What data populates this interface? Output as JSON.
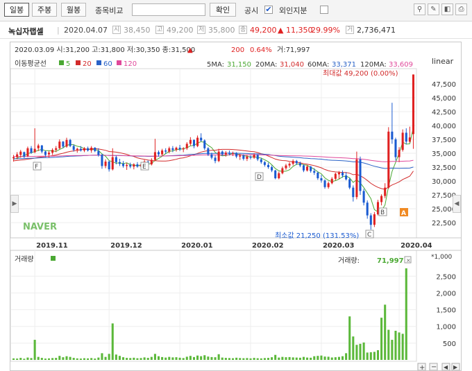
{
  "toolbar": {
    "period_buttons": [
      "일봉",
      "주봉",
      "월봉"
    ],
    "compare_label": "종목비교",
    "compare_placeholder": "",
    "confirm_button": "확인",
    "disclosure_label": "공시",
    "disclosure_checked": true,
    "foreign_label": "외인지분",
    "foreign_checked": false,
    "icons": [
      "pin-icon",
      "draw-icon",
      "toggle-panel-icon",
      "print-icon"
    ]
  },
  "stock": {
    "name": "녹십자랩셀",
    "date": "2020.04.07",
    "open_badge": "시",
    "open": "38,450",
    "high_badge": "고",
    "high": "49,200",
    "low_badge": "저",
    "low": "35,800",
    "close_badge": "종",
    "close": "49,200",
    "change": "▲ 11,350",
    "change_pct": "29.99%",
    "volume_badge": "거",
    "volume": "2,736,471",
    "up_color": "#e02121",
    "down_color": "#1a5bd1"
  },
  "chart_header": {
    "line1": "2020.03.09 시:31,200 고:31,800 저:30,350 종:31,500",
    "line1_change": "▲",
    "line1_change_val": "200",
    "line1_pct": "0.64%",
    "line1_vol": "거:71,997",
    "ma_title": "이동평균선",
    "ma_legend": [
      {
        "label": "5",
        "color": "#4aa832"
      },
      {
        "label": "20",
        "color": "#d22b2b"
      },
      {
        "label": "60",
        "color": "#2962c7"
      },
      {
        "label": "120",
        "color": "#e0489a"
      }
    ],
    "ma_values": [
      {
        "label": "5MA:",
        "value": "31,150",
        "color": "#4aa832"
      },
      {
        "label": "20MA:",
        "value": "31,040",
        "color": "#d22b2b"
      },
      {
        "label": "60MA:",
        "value": "33,371",
        "color": "#2962c7"
      },
      {
        "label": "120MA:",
        "value": "33,609",
        "color": "#e0489a"
      }
    ],
    "scale_mode": "linear"
  },
  "annotations": {
    "max_label": "최대값 49,200 (0.00%)",
    "min_label": "최소값 21,250 (131.53%)",
    "watermark": "NAVER",
    "markers": [
      "F",
      "E",
      "D",
      "C",
      "B",
      "A"
    ]
  },
  "volume_header": {
    "title": "거래량",
    "value_label": "거래량:",
    "value": "71,997",
    "unit": "*1,000"
  },
  "chart_data": [
    {
      "type": "candlestick",
      "title": "",
      "ylabel": "",
      "x_ticks": [
        "2019.11",
        "2019.12",
        "2020.01",
        "2020.02",
        "2020.03",
        "2020.04"
      ],
      "y_ticks": [
        22500,
        25000,
        27500,
        30000,
        32500,
        35000,
        37500,
        40000,
        42500,
        45000,
        47500
      ],
      "ylim": [
        20000,
        50000
      ],
      "candles": [
        {
          "d": "10-24",
          "o": 34100,
          "h": 34700,
          "l": 33500,
          "c": 34300
        },
        {
          "d": "10-25",
          "o": 34300,
          "h": 35200,
          "l": 33900,
          "c": 34800
        },
        {
          "d": "10-28",
          "o": 34700,
          "h": 35600,
          "l": 34200,
          "c": 35300
        },
        {
          "d": "10-29",
          "o": 35200,
          "h": 35300,
          "l": 34100,
          "c": 34400
        },
        {
          "d": "10-30",
          "o": 34500,
          "h": 36200,
          "l": 34300,
          "c": 35900
        },
        {
          "d": "10-31",
          "o": 35900,
          "h": 36300,
          "l": 34900,
          "c": 35100
        },
        {
          "d": "11-01",
          "o": 35200,
          "h": 39500,
          "l": 35000,
          "c": 35800
        },
        {
          "d": "11-04",
          "o": 35900,
          "h": 36700,
          "l": 35400,
          "c": 36400
        },
        {
          "d": "11-05",
          "o": 36400,
          "h": 36500,
          "l": 35000,
          "c": 35300
        },
        {
          "d": "11-06",
          "o": 35300,
          "h": 35500,
          "l": 34300,
          "c": 34700
        },
        {
          "d": "11-07",
          "o": 34800,
          "h": 35400,
          "l": 34200,
          "c": 35100
        },
        {
          "d": "11-08",
          "o": 35100,
          "h": 35900,
          "l": 34700,
          "c": 35600
        },
        {
          "d": "11-11",
          "o": 35600,
          "h": 36300,
          "l": 35200,
          "c": 35900
        },
        {
          "d": "11-12",
          "o": 35900,
          "h": 37500,
          "l": 35700,
          "c": 37100
        },
        {
          "d": "11-13",
          "o": 37100,
          "h": 37200,
          "l": 35900,
          "c": 36200
        },
        {
          "d": "11-14",
          "o": 36200,
          "h": 37800,
          "l": 36000,
          "c": 37400
        },
        {
          "d": "11-15",
          "o": 37400,
          "h": 37600,
          "l": 36100,
          "c": 36300
        },
        {
          "d": "11-18",
          "o": 36300,
          "h": 36600,
          "l": 35300,
          "c": 35600
        },
        {
          "d": "11-19",
          "o": 35600,
          "h": 36000,
          "l": 35100,
          "c": 35800
        },
        {
          "d": "11-20",
          "o": 35800,
          "h": 36300,
          "l": 35300,
          "c": 35500
        },
        {
          "d": "11-21",
          "o": 35500,
          "h": 36100,
          "l": 35200,
          "c": 35900
        },
        {
          "d": "11-22",
          "o": 35900,
          "h": 36200,
          "l": 35300,
          "c": 35500
        },
        {
          "d": "11-25",
          "o": 35500,
          "h": 36300,
          "l": 35100,
          "c": 36000
        },
        {
          "d": "11-26",
          "o": 36000,
          "h": 36100,
          "l": 35200,
          "c": 35400
        },
        {
          "d": "11-27",
          "o": 35400,
          "h": 35900,
          "l": 34400,
          "c": 34700
        },
        {
          "d": "11-28",
          "o": 34700,
          "h": 34900,
          "l": 32200,
          "c": 32700
        },
        {
          "d": "11-29",
          "o": 32700,
          "h": 33900,
          "l": 32300,
          "c": 33500
        },
        {
          "d": "12-02",
          "o": 33500,
          "h": 33700,
          "l": 31700,
          "c": 32100
        },
        {
          "d": "12-03",
          "o": 32100,
          "h": 35900,
          "l": 31900,
          "c": 34300
        },
        {
          "d": "12-04",
          "o": 34300,
          "h": 34600,
          "l": 33000,
          "c": 33400
        },
        {
          "d": "12-05",
          "o": 33400,
          "h": 34000,
          "l": 32700,
          "c": 33100
        },
        {
          "d": "12-06",
          "o": 33100,
          "h": 33600,
          "l": 32400,
          "c": 32700
        },
        {
          "d": "12-09",
          "o": 32700,
          "h": 33300,
          "l": 32000,
          "c": 32900
        },
        {
          "d": "12-10",
          "o": 32900,
          "h": 33300,
          "l": 32300,
          "c": 32600
        },
        {
          "d": "12-11",
          "o": 32600,
          "h": 33200,
          "l": 32100,
          "c": 33000
        },
        {
          "d": "12-12",
          "o": 33000,
          "h": 33400,
          "l": 32400,
          "c": 32600
        },
        {
          "d": "12-13",
          "o": 32600,
          "h": 33200,
          "l": 32300,
          "c": 33000
        },
        {
          "d": "12-16",
          "o": 33000,
          "h": 33800,
          "l": 32600,
          "c": 33500
        },
        {
          "d": "12-17",
          "o": 33500,
          "h": 33700,
          "l": 32700,
          "c": 33000
        },
        {
          "d": "12-18",
          "o": 33000,
          "h": 34100,
          "l": 32800,
          "c": 33800
        },
        {
          "d": "12-19",
          "o": 33800,
          "h": 37600,
          "l": 33600,
          "c": 35200
        },
        {
          "d": "12-20",
          "o": 35200,
          "h": 35500,
          "l": 34400,
          "c": 34800
        },
        {
          "d": "12-23",
          "o": 34800,
          "h": 35800,
          "l": 34500,
          "c": 35500
        },
        {
          "d": "12-24",
          "o": 35500,
          "h": 35900,
          "l": 34900,
          "c": 35300
        },
        {
          "d": "12-26",
          "o": 35300,
          "h": 36200,
          "l": 35000,
          "c": 35900
        },
        {
          "d": "12-27",
          "o": 35900,
          "h": 36300,
          "l": 35200,
          "c": 35600
        },
        {
          "d": "12-30",
          "o": 35600,
          "h": 36200,
          "l": 35300,
          "c": 36000
        },
        {
          "d": "01-02",
          "o": 36000,
          "h": 36500,
          "l": 35400,
          "c": 35700
        },
        {
          "d": "01-03",
          "o": 35700,
          "h": 36100,
          "l": 35200,
          "c": 35900
        },
        {
          "d": "01-06",
          "o": 35900,
          "h": 37000,
          "l": 35600,
          "c": 36700
        },
        {
          "d": "01-07",
          "o": 36700,
          "h": 37900,
          "l": 36400,
          "c": 37400
        },
        {
          "d": "01-08",
          "o": 37400,
          "h": 37500,
          "l": 35900,
          "c": 36300
        },
        {
          "d": "01-09",
          "o": 36300,
          "h": 38200,
          "l": 36100,
          "c": 37800
        },
        {
          "d": "01-10",
          "o": 37800,
          "h": 38600,
          "l": 37100,
          "c": 37300
        },
        {
          "d": "01-13",
          "o": 37300,
          "h": 37500,
          "l": 35600,
          "c": 35900
        },
        {
          "d": "01-14",
          "o": 35900,
          "h": 36100,
          "l": 34500,
          "c": 34800
        },
        {
          "d": "01-15",
          "o": 34800,
          "h": 35100,
          "l": 33900,
          "c": 34200
        },
        {
          "d": "01-16",
          "o": 34200,
          "h": 34600,
          "l": 33200,
          "c": 33600
        },
        {
          "d": "01-17",
          "o": 33600,
          "h": 35800,
          "l": 33400,
          "c": 35300
        },
        {
          "d": "01-20",
          "o": 35300,
          "h": 35500,
          "l": 34500,
          "c": 34800
        },
        {
          "d": "01-21",
          "o": 34800,
          "h": 35400,
          "l": 34400,
          "c": 35100
        },
        {
          "d": "01-22",
          "o": 35100,
          "h": 35500,
          "l": 34600,
          "c": 34900
        },
        {
          "d": "01-23",
          "o": 34900,
          "h": 35300,
          "l": 34500,
          "c": 35000
        },
        {
          "d": "01-28",
          "o": 35000,
          "h": 35200,
          "l": 34100,
          "c": 34400
        },
        {
          "d": "01-29",
          "o": 34400,
          "h": 34900,
          "l": 33800,
          "c": 34600
        },
        {
          "d": "01-30",
          "o": 34600,
          "h": 34800,
          "l": 33700,
          "c": 34000
        },
        {
          "d": "01-31",
          "o": 34000,
          "h": 34700,
          "l": 33600,
          "c": 34400
        },
        {
          "d": "02-03",
          "o": 34400,
          "h": 34600,
          "l": 33900,
          "c": 34200
        },
        {
          "d": "02-04",
          "o": 34200,
          "h": 35000,
          "l": 34000,
          "c": 34700
        },
        {
          "d": "02-05",
          "o": 34700,
          "h": 34800,
          "l": 33600,
          "c": 33900
        },
        {
          "d": "02-06",
          "o": 33900,
          "h": 34200,
          "l": 33100,
          "c": 33400
        },
        {
          "d": "02-07",
          "o": 33400,
          "h": 33600,
          "l": 32600,
          "c": 32900
        },
        {
          "d": "02-10",
          "o": 32900,
          "h": 33300,
          "l": 32200,
          "c": 32500
        },
        {
          "d": "02-11",
          "o": 32500,
          "h": 32800,
          "l": 31600,
          "c": 31900
        },
        {
          "d": "02-12",
          "o": 31900,
          "h": 32000,
          "l": 30300,
          "c": 30500
        },
        {
          "d": "02-13",
          "o": 30500,
          "h": 31700,
          "l": 30300,
          "c": 31400
        },
        {
          "d": "02-14",
          "o": 31400,
          "h": 32600,
          "l": 31200,
          "c": 32300
        },
        {
          "d": "02-17",
          "o": 32300,
          "h": 33100,
          "l": 32000,
          "c": 32800
        },
        {
          "d": "02-18",
          "o": 32800,
          "h": 33400,
          "l": 32400,
          "c": 33100
        },
        {
          "d": "02-19",
          "o": 33100,
          "h": 33900,
          "l": 32800,
          "c": 33600
        },
        {
          "d": "02-20",
          "o": 33600,
          "h": 33800,
          "l": 32900,
          "c": 33200
        },
        {
          "d": "02-21",
          "o": 33200,
          "h": 33500,
          "l": 32500,
          "c": 32800
        },
        {
          "d": "02-24",
          "o": 32800,
          "h": 33000,
          "l": 31600,
          "c": 31900
        },
        {
          "d": "02-25",
          "o": 31900,
          "h": 32900,
          "l": 31700,
          "c": 32600
        },
        {
          "d": "02-26",
          "o": 32600,
          "h": 32700,
          "l": 31500,
          "c": 31800
        },
        {
          "d": "02-27",
          "o": 31800,
          "h": 32300,
          "l": 31100,
          "c": 31500
        },
        {
          "d": "02-28",
          "o": 31500,
          "h": 31700,
          "l": 30200,
          "c": 30500
        },
        {
          "d": "03-02",
          "o": 30500,
          "h": 31100,
          "l": 29700,
          "c": 30100
        },
        {
          "d": "03-03",
          "o": 30100,
          "h": 30300,
          "l": 28600,
          "c": 28900
        },
        {
          "d": "03-04",
          "o": 28900,
          "h": 29900,
          "l": 28600,
          "c": 29600
        },
        {
          "d": "03-05",
          "o": 29600,
          "h": 30700,
          "l": 29400,
          "c": 30400
        },
        {
          "d": "03-06",
          "o": 30400,
          "h": 31500,
          "l": 30100,
          "c": 31300
        },
        {
          "d": "03-09",
          "o": 31200,
          "h": 31800,
          "l": 30350,
          "c": 31500
        },
        {
          "d": "03-10",
          "o": 31500,
          "h": 31900,
          "l": 30600,
          "c": 31000
        },
        {
          "d": "03-11",
          "o": 31000,
          "h": 31600,
          "l": 30100,
          "c": 30300
        },
        {
          "d": "03-12",
          "o": 30300,
          "h": 30600,
          "l": 28500,
          "c": 28800
        },
        {
          "d": "03-13",
          "o": 28800,
          "h": 29200,
          "l": 26300,
          "c": 27100
        },
        {
          "d": "03-16",
          "o": 27100,
          "h": 35300,
          "l": 26700,
          "c": 33900
        },
        {
          "d": "03-17",
          "o": 33900,
          "h": 34400,
          "l": 27500,
          "c": 28200
        },
        {
          "d": "03-18",
          "o": 28200,
          "h": 28600,
          "l": 25600,
          "c": 26100
        },
        {
          "d": "03-19",
          "o": 26100,
          "h": 26500,
          "l": 23200,
          "c": 23800
        },
        {
          "d": "03-20",
          "o": 23800,
          "h": 24200,
          "l": 21250,
          "c": 22100
        },
        {
          "d": "03-23",
          "o": 22100,
          "h": 24400,
          "l": 21700,
          "c": 24000
        },
        {
          "d": "03-24",
          "o": 24000,
          "h": 26600,
          "l": 23800,
          "c": 26200
        },
        {
          "d": "03-25",
          "o": 26200,
          "h": 27600,
          "l": 25600,
          "c": 27300
        },
        {
          "d": "03-26",
          "o": 27300,
          "h": 29600,
          "l": 26900,
          "c": 28800
        },
        {
          "d": "03-27",
          "o": 28800,
          "h": 39700,
          "l": 28600,
          "c": 38900
        },
        {
          "d": "03-30",
          "o": 38900,
          "h": 44100,
          "l": 36700,
          "c": 37500
        },
        {
          "d": "03-31",
          "o": 37500,
          "h": 37800,
          "l": 33700,
          "c": 34300
        },
        {
          "d": "04-01",
          "o": 34300,
          "h": 36100,
          "l": 33400,
          "c": 35600
        },
        {
          "d": "04-02",
          "o": 35600,
          "h": 39300,
          "l": 35300,
          "c": 38700
        },
        {
          "d": "04-03",
          "o": 38700,
          "h": 39500,
          "l": 36600,
          "c": 37100
        },
        {
          "d": "04-06",
          "o": 37100,
          "h": 39800,
          "l": 36900,
          "c": 37850
        },
        {
          "d": "04-07",
          "o": 38450,
          "h": 49200,
          "l": 35800,
          "c": 49200
        }
      ],
      "ma_periods": [
        5,
        20,
        60,
        120
      ],
      "ma_colors": [
        "#4aa832",
        "#d22b2b",
        "#2962c7",
        "#e0489a"
      ],
      "ma_end_values": {
        "ma5": 31150,
        "ma20": 31040,
        "ma60": 33371,
        "ma120": 33609
      }
    },
    {
      "type": "bar",
      "title": "",
      "ylabel": "",
      "unit": "*1,000",
      "y_ticks": [
        500,
        1000,
        1500,
        2000,
        2500
      ],
      "ylim": [
        0,
        2900
      ],
      "volumes": [
        45,
        40,
        60,
        35,
        70,
        55,
        600,
        90,
        60,
        40,
        45,
        55,
        60,
        120,
        80,
        110,
        90,
        60,
        45,
        40,
        50,
        45,
        55,
        40,
        70,
        200,
        90,
        180,
        1090,
        160,
        120,
        80,
        60,
        55,
        65,
        50,
        55,
        75,
        60,
        90,
        180,
        110,
        85,
        70,
        90,
        75,
        80,
        65,
        55,
        95,
        120,
        85,
        130,
        110,
        140,
        100,
        85,
        80,
        170,
        70,
        60,
        55,
        50,
        65,
        55,
        50,
        55,
        45,
        60,
        50,
        45,
        55,
        60,
        80,
        150,
        70,
        90,
        80,
        85,
        75,
        70,
        65,
        90,
        70,
        65,
        110,
        120,
        130,
        100,
        95,
        72,
        80,
        90,
        110,
        200,
        1300,
        700,
        450,
        480,
        520,
        220,
        230,
        240,
        290,
        1260,
        1650,
        900,
        600,
        870,
        820,
        780,
        2736
      ]
    }
  ]
}
